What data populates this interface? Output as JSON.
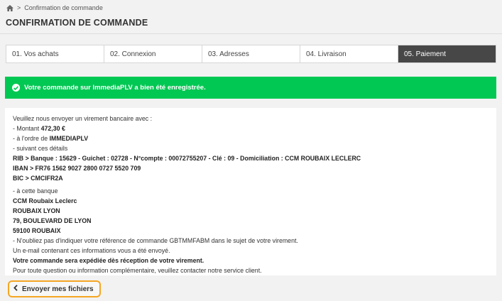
{
  "breadcrumb": {
    "home_icon": "home-icon",
    "separator": ">",
    "current": "Confirmation de commande"
  },
  "page": {
    "title": "CONFIRMATION DE COMMANDE"
  },
  "steps": [
    {
      "label": "01. Vos achats"
    },
    {
      "label": "02. Connexion"
    },
    {
      "label": "03. Adresses"
    },
    {
      "label": "04. Livraison"
    },
    {
      "label": "05. Paiement"
    }
  ],
  "alert": {
    "icon": "check-circle-icon",
    "message": "Votre commande sur ImmediaPLV a bien été enregistrée.",
    "color": "#00c853"
  },
  "details": {
    "intro": "Veuillez nous envoyer un virement bancaire avec :",
    "amount_prefix": "- Montant ",
    "amount": "472,30 €",
    "order_prefix": "- à l'ordre de ",
    "payee": "IMMEDIAPLV",
    "details_label": "- suivant ces détails",
    "rib": "RIB > Banque : 15629 - Guichet : 02728 - N°compte : 00072755207 - Clé : 09 - Domiciliation : CCM ROUBAIX LECLERC",
    "iban": "IBAN > FR76 1562 9027 2800 0727 5520 709",
    "bic": "BIC > CMCIFR2A",
    "bank_label": "- à cette banque",
    "bank_name": "CCM Roubaix Leclerc",
    "bank_city": "ROUBAIX LYON",
    "bank_street": "79, BOULEVARD DE LYON",
    "bank_postcode": "59100 ROUBAIX",
    "reference_note": "- N'oubliez pas d'indiquer votre référence de commande GBTMMFABM dans le sujet de votre virement.",
    "email_note": "Un e-mail contenant ces informations vous a été envoyé.",
    "shipping_note": "Votre commande sera expédiée dès réception de votre virement.",
    "contact_note": "Pour toute question ou information complémentaire, veuillez contacter notre service client."
  },
  "back_button": {
    "icon": "chevron-left-icon",
    "label": "Envoyer mes fichiers",
    "border_color": "#f5a623"
  }
}
